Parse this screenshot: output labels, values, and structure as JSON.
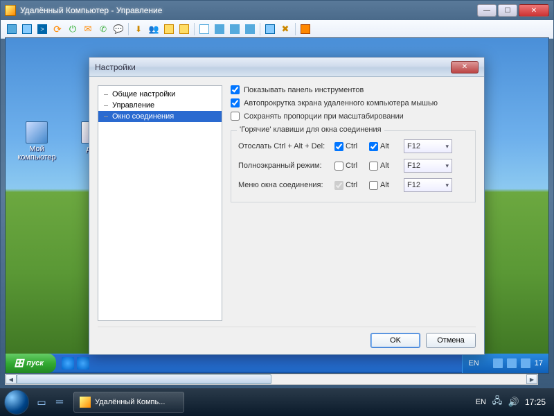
{
  "window": {
    "title": "Удалённый Компьютер - Управление"
  },
  "desktop_icons": [
    {
      "label": "Мой\nкомпьютер"
    },
    {
      "label": "док"
    }
  ],
  "dialog": {
    "title": "Настройки",
    "tree": {
      "items": [
        "Общие настройки",
        "Управление",
        "Окно соединения"
      ],
      "selected": 2
    },
    "checks": {
      "show_toolbar": "Показывать панель инструментов",
      "autoscroll": "Автопрокрутка экрана удаленного компьютера мышью",
      "aspect": "Сохранять пропорции при масштабировании"
    },
    "group_label": "'Горячие' клавиши для окна соединения",
    "rows": [
      {
        "label": "Отослать Ctrl + Alt + Del:",
        "ctrl": true,
        "alt": true,
        "ctrl_en": true,
        "alt_en": true,
        "combo": "F12"
      },
      {
        "label": "Полноэкранный режим:",
        "ctrl": false,
        "alt": false,
        "ctrl_en": true,
        "alt_en": true,
        "combo": "F12"
      },
      {
        "label": "Меню окна соединения:",
        "ctrl": true,
        "alt": false,
        "ctrl_en": false,
        "alt_en": true,
        "combo": "F12"
      }
    ],
    "col_ctrl": "Ctrl",
    "col_alt": "Alt",
    "ok": "OK",
    "cancel": "Отмена"
  },
  "xp": {
    "start": "пуск",
    "lang": "EN",
    "time": "17"
  },
  "vista": {
    "task": "Удалённый Компь...",
    "lang": "EN",
    "time": "17:25"
  }
}
